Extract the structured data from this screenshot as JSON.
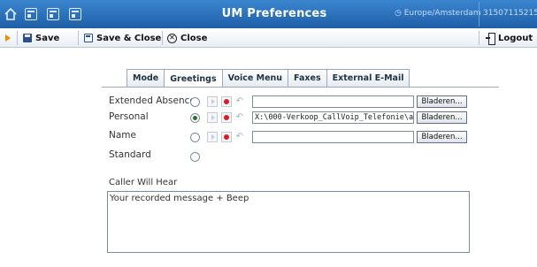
{
  "window": {
    "title": "UM Preferences",
    "timezone": "Europe/Amsterdam",
    "account": "31507115215"
  },
  "toolbar": {
    "save_label": "Save",
    "save_close_label": "Save & Close",
    "close_label": "Close",
    "logout_label": "Logout"
  },
  "tabs": [
    {
      "label": "Mode"
    },
    {
      "label": "Greetings"
    },
    {
      "label": "Voice Menu"
    },
    {
      "label": "Faxes"
    },
    {
      "label": "External E-Mail"
    }
  ],
  "active_tab": "Greetings",
  "greetings": [
    {
      "label": "Extended Absence",
      "selected": false,
      "file_value": "",
      "browse_label": "Bladeren..."
    },
    {
      "label": "Personal",
      "selected": true,
      "file_value": "X:\\000-Verkoop_CallVoip_Telefonie\\a",
      "browse_label": "Bladeren..."
    },
    {
      "label": "Name",
      "selected": false,
      "file_value": "",
      "browse_label": "Bladeren..."
    },
    {
      "label": "Standard",
      "selected": false
    }
  ],
  "caller_will_hear": {
    "label": "Caller Will Hear",
    "value": "Your recorded message + Beep"
  },
  "colors": {
    "titlebar": "#1f5fa8",
    "record": "#e0182a",
    "accent": "#f08a00"
  }
}
